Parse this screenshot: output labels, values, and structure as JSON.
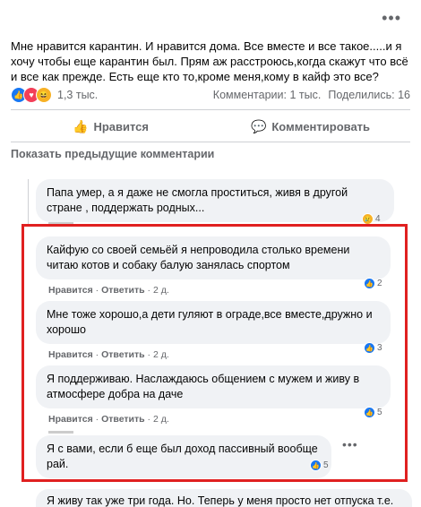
{
  "post": {
    "menu": "•••",
    "text": "Мне нравится карантин. И нравится дома. Все вместе и все такое.....и я хочу чтобы еще карантин был. Прям аж расстроюсь,когда скажут что всё и все как прежде. Есть еще кто то,кроме меня,кому в кайф это все?",
    "reactions_count": "1,3 тыс.",
    "comments_count": "Комментарии: 1 тыс.",
    "shares_count": "Поделились: 16",
    "like_label": "Нравится",
    "comment_label": "Комментировать"
  },
  "prev_comments_label": "Показать предыдущие комментарии",
  "comments": [
    {
      "text": "Папа умер, а я даже не смогла проститься, живя в другой стране , поддержать родных...",
      "reactions": "4",
      "reaction_icon": "sad-icon"
    },
    {
      "text": "Кайфую со своей семьёй я непроводила столько времени читаю котов и собаку балую занялась спортом",
      "like": "Нравится",
      "reply": "Ответить",
      "time": "2 д.",
      "reactions": "2"
    },
    {
      "text": "Мне тоже хорошо,а дети гуляют в ограде,все вместе,дружно и хорошо",
      "like": "Нравится",
      "reply": "Ответить",
      "time": "2 д.",
      "reactions": "3"
    },
    {
      "text": "Я поддерживаю. Наслаждаюсь общением с мужем и живу в атмосфере добра на даче",
      "like": "Нравится",
      "reply": "Ответить",
      "time": "2 д.",
      "reactions": "5"
    },
    {
      "text": "Я с вами, если б еще был доход пассивный вообще рай.",
      "reactions": "5"
    },
    {
      "text": "Я живу так уже три года. Но. Теперь у меня просто нет отпуска т.е."
    }
  ],
  "more_glyph": "•••",
  "colors": {
    "accent": "#1877f2",
    "highlight": "#e02020",
    "bubble": "#f0f2f5"
  }
}
